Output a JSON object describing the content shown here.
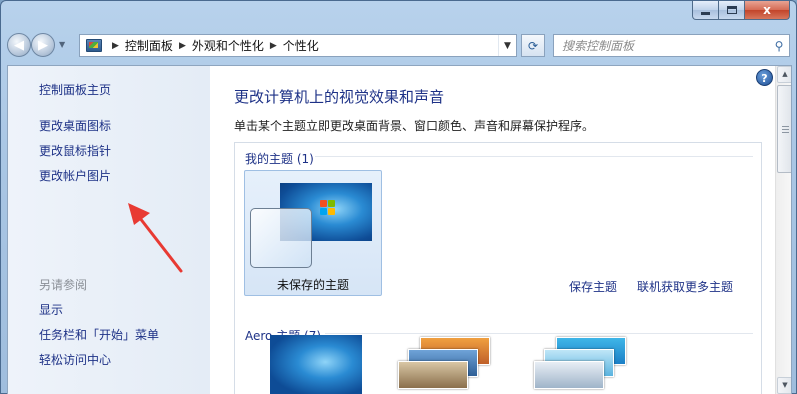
{
  "window": {
    "caption_buttons": {
      "close_glyph": "x"
    }
  },
  "nav": {
    "breadcrumb": [
      "控制面板",
      "外观和个性化",
      "个性化"
    ],
    "search_placeholder": "搜索控制面板"
  },
  "sidebar": {
    "home_link": "控制面板主页",
    "tasks": [
      "更改桌面图标",
      "更改鼠标指针",
      "更改帐户图片"
    ],
    "see_also_title": "另请参阅",
    "see_also": [
      "显示",
      "任务栏和「开始」菜单",
      "轻松访问中心"
    ]
  },
  "main": {
    "title": "更改计算机上的视觉效果和声音",
    "description": "单击某个主题立即更改桌面背景、窗口颜色、声音和屏幕保护程序。",
    "my_themes_header": "我的主题 (1)",
    "selected_theme_name": "未保存的主题",
    "save_theme_link": "保存主题",
    "get_more_link": "联机获取更多主题",
    "aero_header": "Aero 主题 (7)"
  },
  "colors": {
    "link": "#1e3287",
    "annotation_arrow": "#e83a33",
    "selection_bg": "#dbe8f7"
  }
}
